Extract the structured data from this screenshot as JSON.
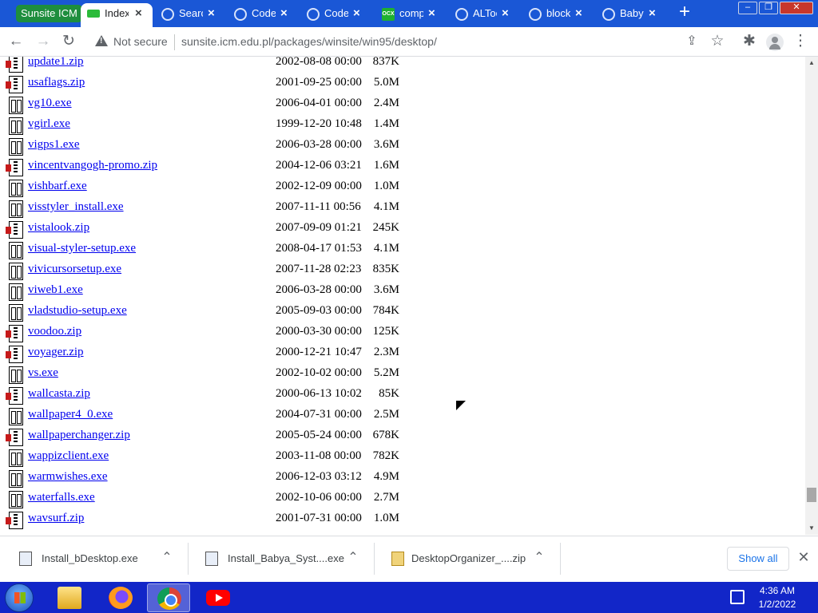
{
  "browser": {
    "tab_group": "Sunsite ICM",
    "tabs": [
      {
        "title": "Index",
        "close": "×"
      },
      {
        "title": "Search",
        "close": "×"
      },
      {
        "title": "Code",
        "close": "×"
      },
      {
        "title": "Code",
        "close": "×"
      },
      {
        "title": "comp",
        "close": "×"
      },
      {
        "title": "ALTools",
        "close": "×"
      },
      {
        "title": "block",
        "close": "×"
      },
      {
        "title": "Babya",
        "close": "×"
      }
    ],
    "new_tab": "+",
    "window_controls": {
      "minimize": "–",
      "restore": "❐",
      "close": "✕"
    },
    "nav": {
      "back": "←",
      "forward": "→",
      "reload": "↻",
      "share": "⇪",
      "bookmark": "☆",
      "extensions": "✱",
      "menu": "⋮"
    },
    "security_label": "Not secure",
    "url": "sunsite.icm.edu.pl/packages/winsite/win95/desktop/",
    "tab_favicon_ocx": "OCX"
  },
  "files": [
    {
      "name": "update1.zip",
      "date": "2002-08-08 00:00",
      "size": "837K",
      "type": "zip"
    },
    {
      "name": "usaflags.zip",
      "date": "2001-09-25 00:00",
      "size": "5.0M",
      "type": "zip"
    },
    {
      "name": "vg10.exe",
      "date": "2006-04-01 00:00",
      "size": "2.4M",
      "type": "exe"
    },
    {
      "name": "vgirl.exe",
      "date": "1999-12-20 10:48",
      "size": "1.4M",
      "type": "exe"
    },
    {
      "name": "vigps1.exe",
      "date": "2006-03-28 00:00",
      "size": "3.6M",
      "type": "exe"
    },
    {
      "name": "vincentvangogh-promo.zip",
      "date": "2004-12-06 03:21",
      "size": "1.6M",
      "type": "zip"
    },
    {
      "name": "vishbarf.exe",
      "date": "2002-12-09 00:00",
      "size": "1.0M",
      "type": "exe"
    },
    {
      "name": "visstyler_install.exe",
      "date": "2007-11-11 00:56",
      "size": "4.1M",
      "type": "exe"
    },
    {
      "name": "vistalook.zip",
      "date": "2007-09-09 01:21",
      "size": "245K",
      "type": "zip"
    },
    {
      "name": "visual-styler-setup.exe",
      "date": "2008-04-17 01:53",
      "size": "4.1M",
      "type": "exe"
    },
    {
      "name": "vivicursorsetup.exe",
      "date": "2007-11-28 02:23",
      "size": "835K",
      "type": "exe"
    },
    {
      "name": "viweb1.exe",
      "date": "2006-03-28 00:00",
      "size": "3.6M",
      "type": "exe"
    },
    {
      "name": "vladstudio-setup.exe",
      "date": "2005-09-03 00:00",
      "size": "784K",
      "type": "exe"
    },
    {
      "name": "voodoo.zip",
      "date": "2000-03-30 00:00",
      "size": "125K",
      "type": "zip"
    },
    {
      "name": "voyager.zip",
      "date": "2000-12-21 10:47",
      "size": "2.3M",
      "type": "zip"
    },
    {
      "name": "vs.exe",
      "date": "2002-10-02 00:00",
      "size": "5.2M",
      "type": "exe"
    },
    {
      "name": "wallcasta.zip",
      "date": "2000-06-13 10:02",
      "size": "85K",
      "type": "zip"
    },
    {
      "name": "wallpaper4_0.exe",
      "date": "2004-07-31 00:00",
      "size": "2.5M",
      "type": "exe"
    },
    {
      "name": "wallpaperchanger.zip",
      "date": "2005-05-24 00:00",
      "size": "678K",
      "type": "zip"
    },
    {
      "name": "wappizclient.exe",
      "date": "2003-11-08 00:00",
      "size": "782K",
      "type": "exe"
    },
    {
      "name": "warmwishes.exe",
      "date": "2006-12-03 03:12",
      "size": "4.9M",
      "type": "exe"
    },
    {
      "name": "waterfalls.exe",
      "date": "2002-10-06 00:00",
      "size": "2.7M",
      "type": "exe"
    },
    {
      "name": "wavsurf.zip",
      "date": "2001-07-31 00:00",
      "size": "1.0M",
      "type": "zip"
    }
  ],
  "scrollbar": {
    "up": "▲",
    "down": "▼"
  },
  "downloads": {
    "items": [
      {
        "name": "Install_bDesktop.exe",
        "chevron": "⌃"
      },
      {
        "name": "Install_Babya_Syst....exe",
        "chevron": "⌃"
      },
      {
        "name": "DesktopOrganizer_....zip",
        "chevron": "⌃"
      }
    ],
    "show_all": "Show all",
    "close": "✕"
  },
  "taskbar": {
    "time": "4:36 AM",
    "date": "1/2/2022"
  },
  "colors": {
    "tabstrip": "#1a57d6",
    "tab_group": "#1e8e3e",
    "link": "#0000ee",
    "taskbar": "#1226c8"
  }
}
